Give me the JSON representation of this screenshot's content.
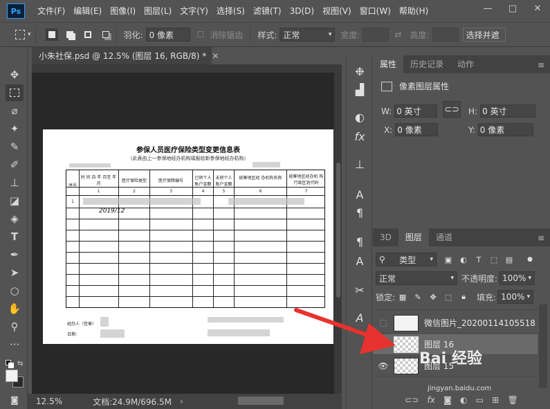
{
  "app": {
    "logo": "Ps"
  },
  "menu": [
    "文件(F)",
    "编辑(E)",
    "图像(I)",
    "图层(L)",
    "文字(Y)",
    "选择(S)",
    "滤镜(T)",
    "3D(D)",
    "视图(V)",
    "窗口(W)",
    "帮助(H)"
  ],
  "window_controls": {
    "minimize": "—",
    "maximize": "□",
    "close": "✕"
  },
  "options": {
    "feather_label": "羽化:",
    "feather_value": "0 像素",
    "antialias_label": "消除锯齿",
    "style_label": "样式:",
    "style_value": "正常",
    "width_label": "宽度:",
    "height_label": "高度:",
    "select_mask": "选择并遮"
  },
  "document": {
    "tab_title": "小朱社保.psd @ 12.5% (图层 16, RGB/8) *",
    "close": "✕",
    "zoom": "12.5%",
    "doc_size": "文档:24.9M/696.5M"
  },
  "canvas_doc": {
    "title": "参保人员医疗保险类型变更信息表",
    "subtitle": "（此表由上一参保地经办机构填报给新参保地经办机构）",
    "headers": [
      "序号",
      "时 间 自 年 月至 年 月",
      "医疗保险类型",
      "医疗保障编号",
      "已转个人 账户金额",
      "未转个人 账户金额",
      "统筹地区经 办机构名称",
      "统筹地区经办机 构行政区划代码"
    ],
    "col_numbers": [
      "1",
      "2",
      "3",
      "4",
      "5",
      "6",
      "7"
    ],
    "row_number": "1",
    "handwriting": "2019/12",
    "footer_agent": "经办人（签章）",
    "footer_date": "日期："
  },
  "tools": [
    "move",
    "marquee",
    "lasso",
    "magic-wand",
    "eyedropper",
    "brush",
    "stamp",
    "eraser",
    "paint-bucket",
    "text",
    "pen",
    "path-select",
    "shape",
    "hand",
    "zoom",
    "more"
  ],
  "properties_panel": {
    "tabs": [
      "属性",
      "历史记录",
      "动作"
    ],
    "header": "像素图层属性",
    "w_label": "W:",
    "w_value": "0 英寸",
    "h_label": "H:",
    "h_value": "0 英寸",
    "x_label": "X:",
    "x_value": "0 像素",
    "y_label": "Y:",
    "y_value": "0 像素"
  },
  "layers_panel": {
    "tabs": [
      "3D",
      "图层",
      "通道"
    ],
    "filter_kind": "类型",
    "blend_mode": "正常",
    "opacity_label": "不透明度:",
    "opacity_value": "100%",
    "lock_label": "锁定:",
    "fill_label": "填充:",
    "fill_value": "100%",
    "layers": [
      {
        "name": "微信图片_20200114105518",
        "visible": false,
        "selected": false
      },
      {
        "name": "图层 16",
        "visible": false,
        "selected": true
      },
      {
        "name": "图层 15",
        "visible": true,
        "selected": false
      }
    ]
  },
  "watermark": {
    "text": "Bai 经验",
    "sub": "jingyan.baidu.com"
  },
  "colors": {
    "accent": "#e8322e",
    "panel_bg": "#535353",
    "dark_bg": "#282828"
  }
}
